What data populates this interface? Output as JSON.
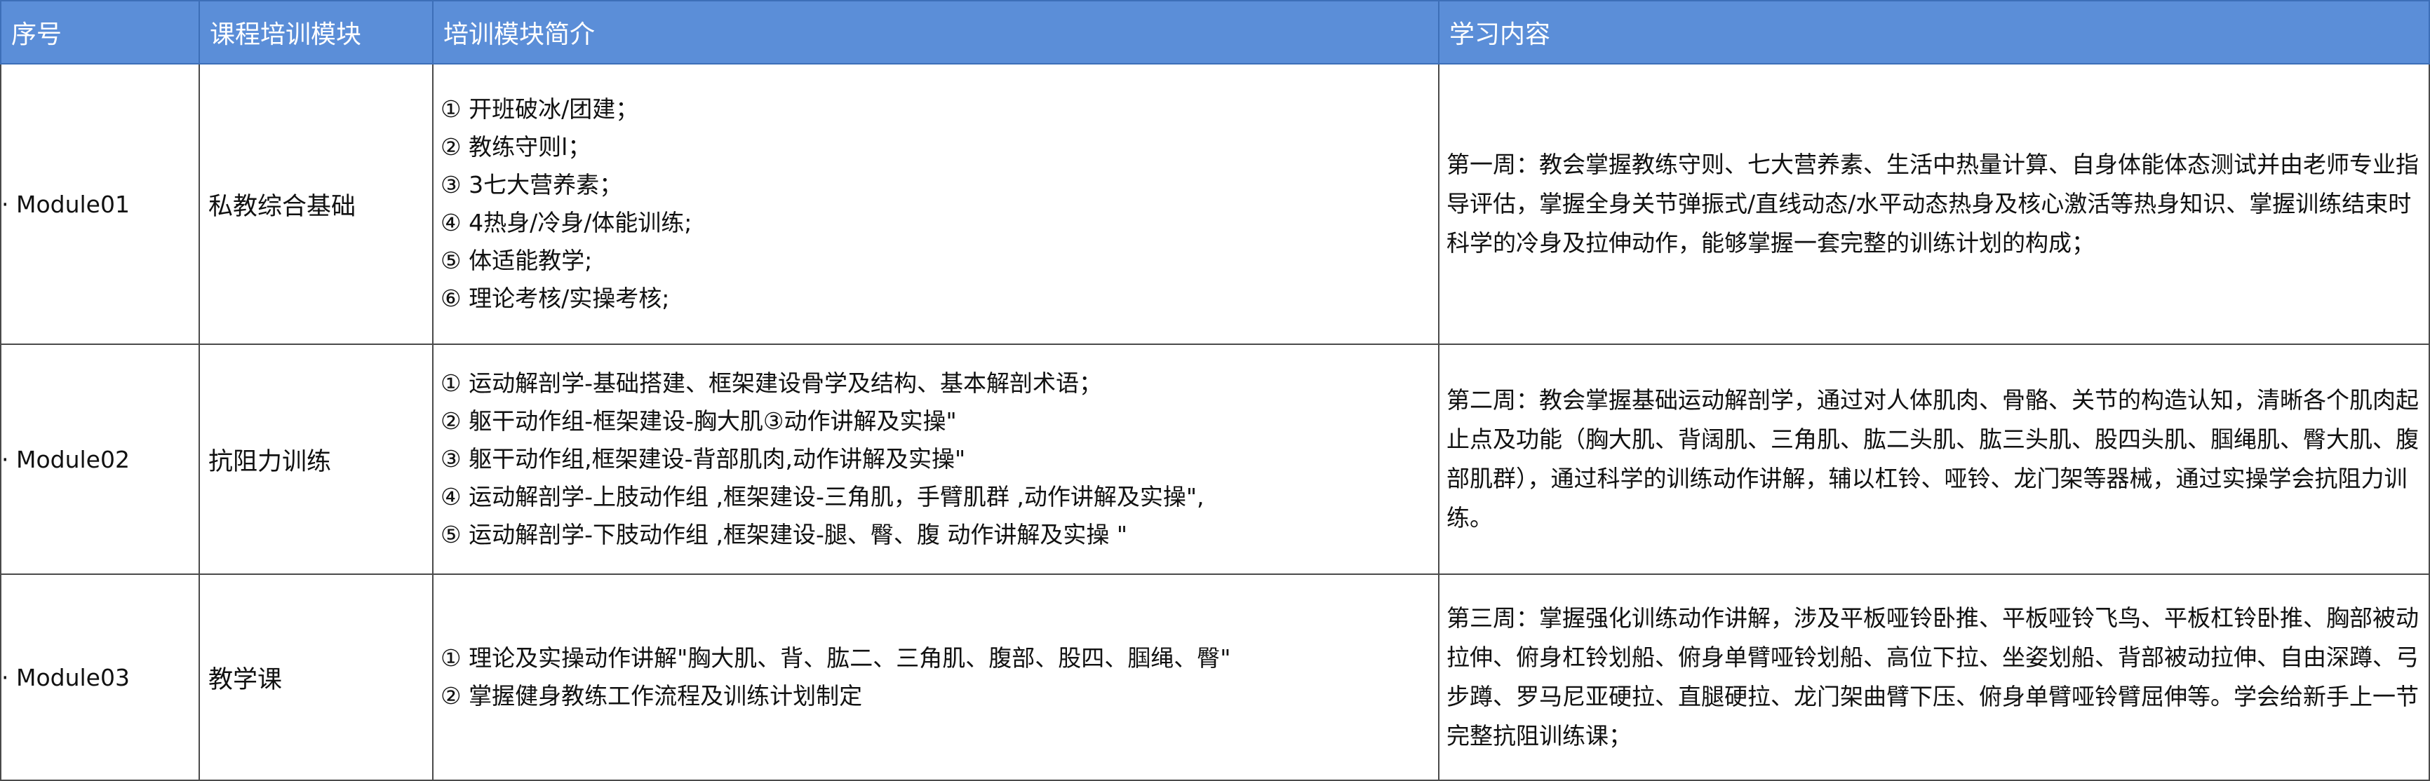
{
  "headers": [
    "序号",
    "课程培训模块",
    "培训模块简介",
    "学习内容"
  ],
  "rows": [
    {
      "index": "· Module01",
      "module": "私教综合基础",
      "intro": [
        "① 开班破冰/团建；",
        "② 教练守则l；",
        "③ 3七大营养素；",
        "④ 4热身/冷身/体能训练;",
        "⑤ 体适能教学;",
        "⑥ 理论考核/实操考核;"
      ],
      "content": "第一周：教会掌握教练守则、七大营养素、生活中热量计算、自身体能体态测试并由老师专业指导评估，掌握全身关节弹振式/直线动态/水平动态热身及核心激活等热身知识、掌握训练结束时科学的冷身及拉伸动作，能够掌握一套完整的训练计划的构成；"
    },
    {
      "index": "· Module02",
      "module": "抗阻力训练",
      "intro": [
        "① 运动解剖学-基础搭建、框架建设骨学及结构、基本解剖术语；",
        "② 躯干动作组-框架建设-胸大肌③动作讲解及实操\"",
        "③ 躯干动作组,框架建设-背部肌肉,动作讲解及实操\"",
        "④ 运动解剖学-上肢动作组 ,框架建设-三角肌，手臂肌群 ,动作讲解及实操\",",
        "⑤ 运动解剖学-下肢动作组 ,框架建设-腿、臀、腹  动作讲解及实操 \""
      ],
      "content": "第二周：教会掌握基础运动解剖学，通过对人体肌肉、骨骼、关节的构造认知，清晰各个肌肉起止点及功能（胸大肌、背阔肌、三角肌、肱二头肌、肱三头肌、股四头肌、腘绳肌、臀大肌、腹部肌群），通过科学的训练动作讲解，辅以杠铃、哑铃、龙门架等器械，通过实操学会抗阻力训练。"
    },
    {
      "index": "· Module03",
      "module": "教学课",
      "intro": [
        "① 理论及实操动作讲解\"胸大肌、背、肱二、三角肌、腹部、股四、腘绳、臀\"",
        "② 掌握健身教练工作流程及训练计划制定"
      ],
      "content": "第三周：掌握强化训练动作讲解，涉及平板哑铃卧推、平板哑铃飞鸟、平板杠铃卧推、胸部被动拉伸、俯身杠铃划船、俯身单臂哑铃划船、高位下拉、坐姿划船、背部被动拉伸、自由深蹲、弓步蹲、罗马尼亚硬拉、直腿硬拉、龙门架曲臂下压、俯身单臂哑铃臂屈伸等。学会给新手上一节完整抗阻训练课；"
    }
  ]
}
